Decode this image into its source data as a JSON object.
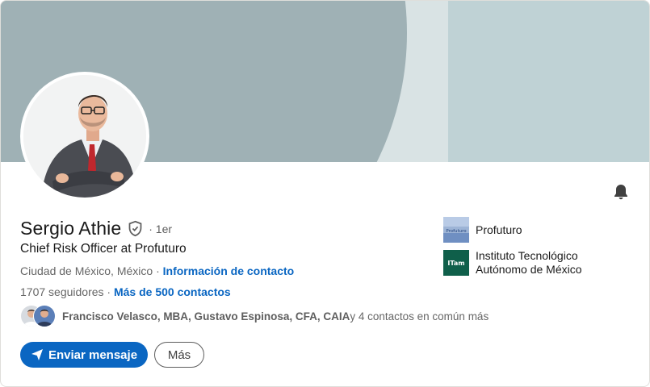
{
  "profile": {
    "name": "Sergio Athie",
    "degree": "· 1er",
    "headline": "Chief Risk Officer at Profuturo",
    "location": "Ciudad de México, México",
    "location_separator": "·",
    "contact_info_link": "Información de contacto",
    "followers": "1707 seguidores",
    "followers_separator": "·",
    "connections_link": "Más de 500 contactos",
    "mutual_names": "Francisco Velasco, MBA, Gustavo Espinosa, CFA, CAIA",
    "mutual_suffix": " y 4 contactos en común más"
  },
  "actions": {
    "message_label": "Enviar mensaje",
    "more_label": "Más"
  },
  "experience": {
    "company": "Profuturo",
    "school_line1": "Instituto Tecnológico",
    "school_line2": "Autónomo de México",
    "school_logo_text": "ITam",
    "company_logo_text": "Profuturo"
  },
  "icons": [
    "verified-shield-icon",
    "bell-icon",
    "send-icon"
  ],
  "colors": {
    "accent": "#0a66c2",
    "banner_light": "#bfd2d5",
    "banner_dark": "#9fb1b5",
    "itam_green": "#0f5f4a"
  }
}
